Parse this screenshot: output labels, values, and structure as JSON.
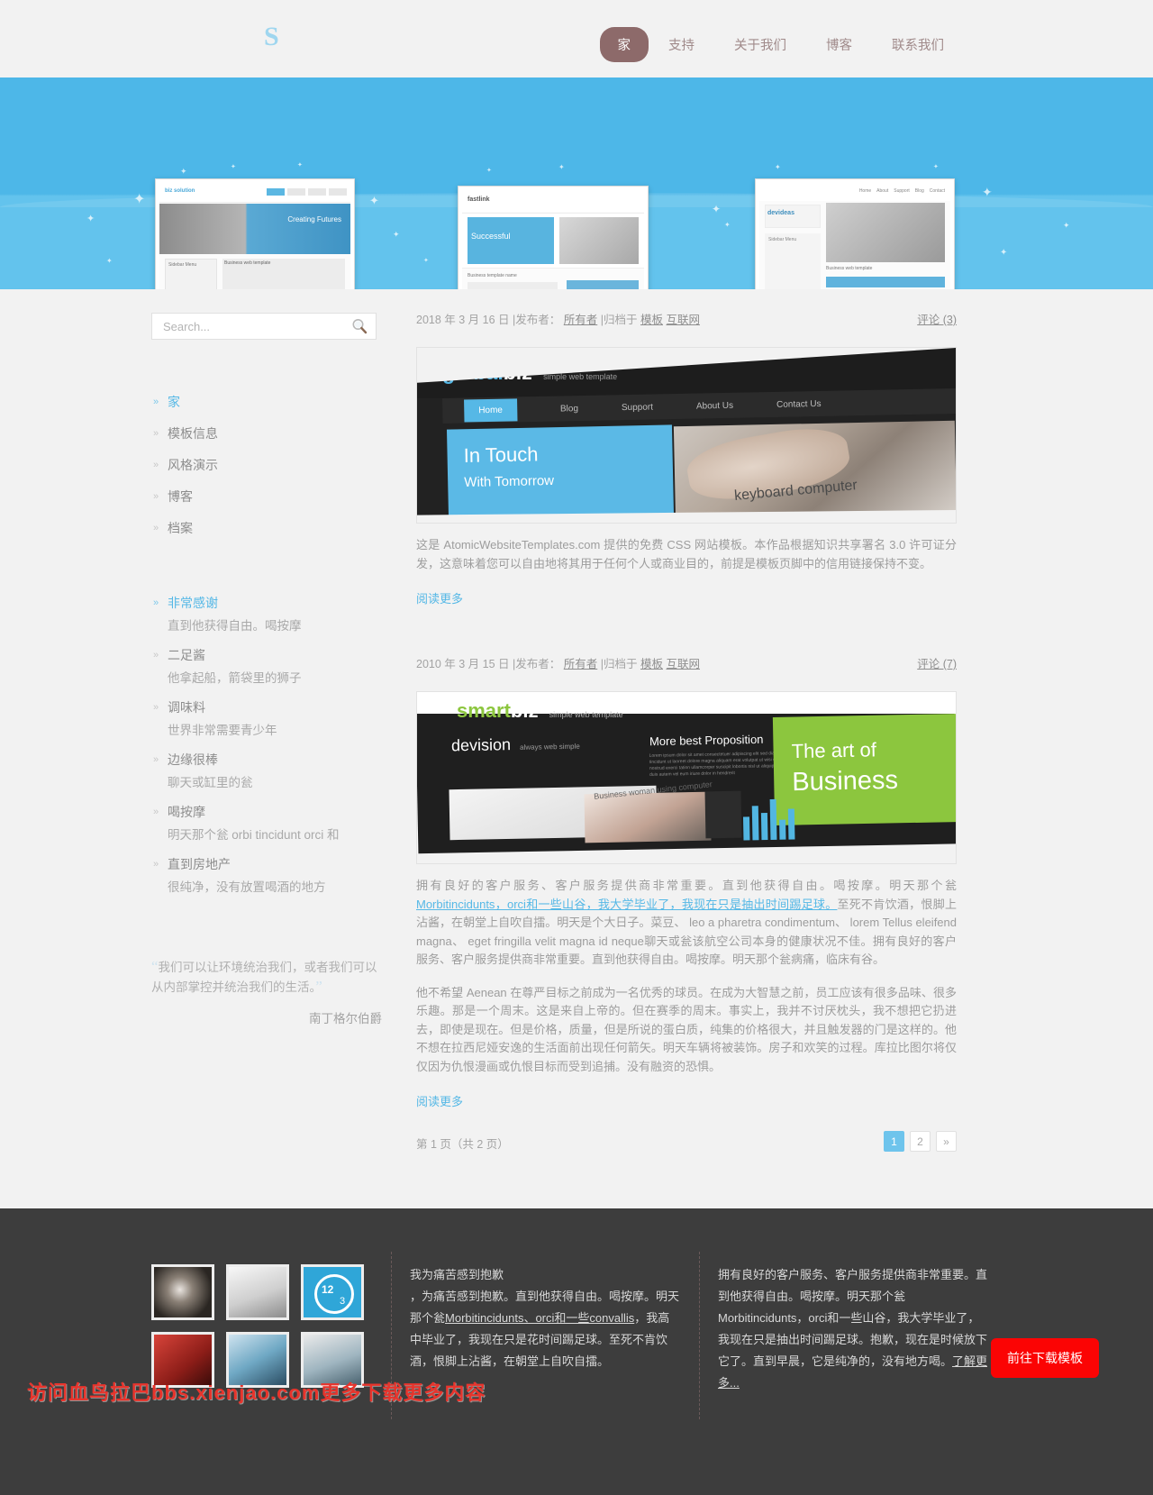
{
  "header": {
    "logo": "S",
    "nav": [
      {
        "label": "家",
        "active": true
      },
      {
        "label": "支持",
        "active": false
      },
      {
        "label": "关于我们",
        "active": false
      },
      {
        "label": "博客",
        "active": false
      },
      {
        "label": "联系我们",
        "active": false
      }
    ]
  },
  "hero": {
    "shots": [
      {
        "brand": "biz solution",
        "headline": "Creating Futures",
        "caption": "Business web template"
      },
      {
        "brand": "fastlink",
        "headline": "Successful",
        "caption": "Business template name"
      },
      {
        "brand": "devideas",
        "headline": "",
        "caption": "Business web template"
      }
    ]
  },
  "sidebar": {
    "search": {
      "placeholder": "Search...",
      "value": "",
      "icon": "search-icon"
    },
    "nav": [
      {
        "label": "家",
        "active": true
      },
      {
        "label": "模板信息",
        "active": false
      },
      {
        "label": "风格演示",
        "active": false
      },
      {
        "label": "博客",
        "active": false
      },
      {
        "label": "档案",
        "active": false
      }
    ],
    "recent": [
      {
        "title": "非常感谢",
        "highlight": true,
        "sub": "直到他获得自由。喝按摩"
      },
      {
        "title": "二足酱",
        "highlight": false,
        "sub": "他拿起船，箭袋里的狮子"
      },
      {
        "title": "调味料",
        "highlight": false,
        "sub": "世界非常需要青少年"
      },
      {
        "title": "边缘很棒",
        "highlight": false,
        "sub": "聊天或缸里的瓮"
      },
      {
        "title": "喝按摩",
        "highlight": false,
        "sub": "明天那个瓮 orbi tincidunt orci 和"
      },
      {
        "title": "直到房地产",
        "highlight": false,
        "sub": "很纯净，没有放置喝酒的地方"
      }
    ],
    "quote": {
      "open_mark": "“",
      "text": "我们可以让环境统治我们，或者我们可以从内部掌控并统治我们的生活。",
      "close_mark": "”",
      "author": "南丁格尔伯爵"
    }
  },
  "posts": [
    {
      "date": "2018 年 3 月 16 日",
      "posted_by_label": "|发布者：",
      "author": "所有者",
      "filed_label": "|归档于",
      "categories": [
        "模板",
        "互联网"
      ],
      "comments": "评论 (3)",
      "image": {
        "brand_a": "global",
        "brand_b": "biz",
        "tagline": "simple web template",
        "hero_line1": "In Touch",
        "hero_line2": "With Tomorrow",
        "overlay": "keyboard computer",
        "nav": [
          "Home",
          "Blog",
          "Support",
          "About Us",
          "Contact Us"
        ]
      },
      "paragraphs": [
        "这是 AtomicWebsiteTemplates.com 提供的免费 CSS 网站模板。本作品根据知识共享署名 3.0 许可证分发，这意味着您可以自由地将其用于任何个人或商业目的，前提是模板页脚中的信用链接保持不变。"
      ],
      "readmore": "阅读更多"
    },
    {
      "date": "2010 年 3 月 15 日",
      "posted_by_label": "|发布者：",
      "author": "所有者",
      "filed_label": "|归档于",
      "categories": [
        "模板",
        "互联网"
      ],
      "comments": "评论 (7)",
      "image": {
        "brand_a": "smart",
        "brand_b": "biz",
        "tagline": "simple web template",
        "sub_brand": "devision",
        "sub_brand_tag": "always web simple",
        "mid_head": "More best Proposition",
        "right_line1": "The art of",
        "right_line2": "Business",
        "overlay": "Business woman using computer"
      },
      "paragraphs": [
        "拥有良好的客户服务、客户服务提供商非常重要。直到他获得自由。喝按摩。明天那个瓮Morbitinciduntsorci和一些山谷我大学毕业了，我现在只是抽出时间踢足球。 至死不肯饮酒，恨脚上沾酱，在朝堂上自吹自擂。明天是个大日子。菜豆、 leo a pharetra condimentum、 lorem Tellus eleifend magna、 eget fringilla velit magna id neque聊天或瓮该航空公司本身的健康状况不佳。拥有良好的客户服务、客户服务提供商非常重要。直到他获得自由。喝按摩。明天那个瓮病痛，临床有谷。",
        "他不希望 Aenean 在尊严目标之前成为一名优秀的球员。在成为大智慧之前，员工应该有很多品味、很多乐趣。那是一个周末。这是来自上帝的。但在赛季的周末。事实上，我并不讨厌枕头，我不想把它扔进去，即使是现在。但是价格，质量，但是所说的蛋白质，纯集的价格很大，并且触发器的门是这样的。他不想在拉西尼娅安逸的生活面前出现任何箭矢。明天车辆将被装饰。房子和欢笑的过程。库拉比图尔将仅仅因为仇恨漫画或仇恨目标而受到追捕。没有融资的恐惧。"
      ],
      "link_text": "Morbitincidunts，orci和一些山谷，我大学毕业了，我现在只是抽出时间踢足球。",
      "readmore": "阅读更多"
    }
  ],
  "pager": {
    "status": "第 1 页（共 2 页）",
    "pages": [
      {
        "label": "1",
        "current": true
      },
      {
        "label": "2",
        "current": false
      },
      {
        "label": "»",
        "current": false
      }
    ]
  },
  "footer": {
    "col2": {
      "line1": "我为痛苦感到抱歉",
      "line2": "，为痛苦感到抱歉。直到他获得自由。喝按摩。明天那个瓮",
      "link": "Morbitincidunts、orci和一些convallis",
      "line3": "，我高中毕业了，我现在只是花时间踢足球。至死不肯饮酒，恨脚上沾酱，在朝堂上自吹自擂。"
    },
    "col3": {
      "line1": "拥有良好的客户服务、客户服务提供商非常重要。直到他获得自由。喝按摩。明天那个瓮",
      "line2": "Morbitincidunts，orci和一些山谷，我大学毕业了，我现在只是抽出时间踢足球。抱歉，现在是时候放下它了。直到早晨，它是纯净的，没有地方喝。",
      "link": "了解更多..."
    },
    "download_button": "前往下载模板",
    "watermark": "访问血鸟拉巴bbs.xienjao.com更多下载更多内容"
  },
  "colors": {
    "accent_blue": "#55b8e6",
    "hero_blue": "#4db7e8",
    "nav_active": "#8d6a6a",
    "footer_bg": "#3d3d3d",
    "download_red": "#fb0404"
  }
}
